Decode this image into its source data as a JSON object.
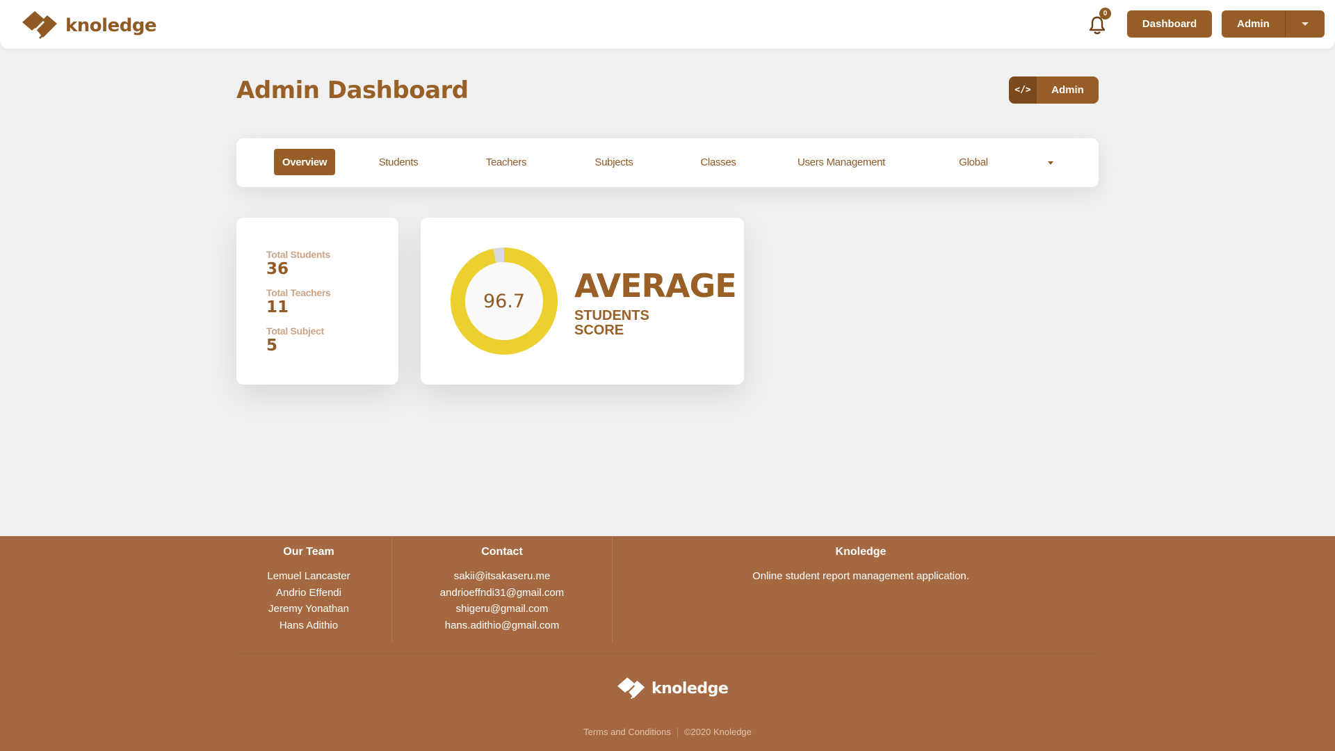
{
  "header": {
    "brand": "knoledge",
    "notifications": {
      "icon": "bell-icon",
      "count": "0"
    },
    "dashboard_label": "Dashboard",
    "admin_label": "Admin",
    "admin_dropdown_icon": "caret-down-icon"
  },
  "page": {
    "title": "Admin Dashboard",
    "role_badge": {
      "icon": "code-icon",
      "glyph": "</>",
      "label": "Admin"
    }
  },
  "nav": {
    "items": [
      {
        "label": "Overview",
        "active": true
      },
      {
        "label": "Students",
        "active": false
      },
      {
        "label": "Teachers",
        "active": false
      },
      {
        "label": "Subjects",
        "active": false
      },
      {
        "label": "Classes",
        "active": false
      },
      {
        "label": "Users Management",
        "active": false
      },
      {
        "label": "Global",
        "active": false,
        "has_dropdown": true
      }
    ]
  },
  "stats": [
    {
      "label": "Total Students",
      "value": "36"
    },
    {
      "label": "Total Teachers",
      "value": "11"
    },
    {
      "label": "Total Subject",
      "value": "5"
    }
  ],
  "score": {
    "value": "96.7",
    "percent": 96.7,
    "title": "AVERAGE",
    "subtitle_line1": "STUDENTS",
    "subtitle_line2": "SCORE",
    "colors": {
      "fill": "#ecd030",
      "remainder": "#d9d9d9",
      "center": "#fafafa"
    }
  },
  "footer": {
    "team": {
      "title": "Our Team",
      "members": [
        "Lemuel Lancaster",
        "Andrio Effendi",
        "Jeremy Yonathan",
        "Hans Adithio"
      ]
    },
    "contact": {
      "title": "Contact",
      "emails": [
        "sakii@itsakaseru.me",
        "andrioeffndi31@gmail.com",
        "shigeru@gmail.com",
        "hans.adithio@gmail.com"
      ]
    },
    "about": {
      "title": "Knoledge",
      "description": "Online student report management application."
    },
    "brand": "knoledge",
    "terms_label": "Terms and Conditions",
    "copyright": "©2020 Knoledge"
  },
  "colors": {
    "brand": "#975d26",
    "brand_dark": "#7a4a1c",
    "footer_bg": "#a56941",
    "page_bg": "#f0f0f0"
  }
}
